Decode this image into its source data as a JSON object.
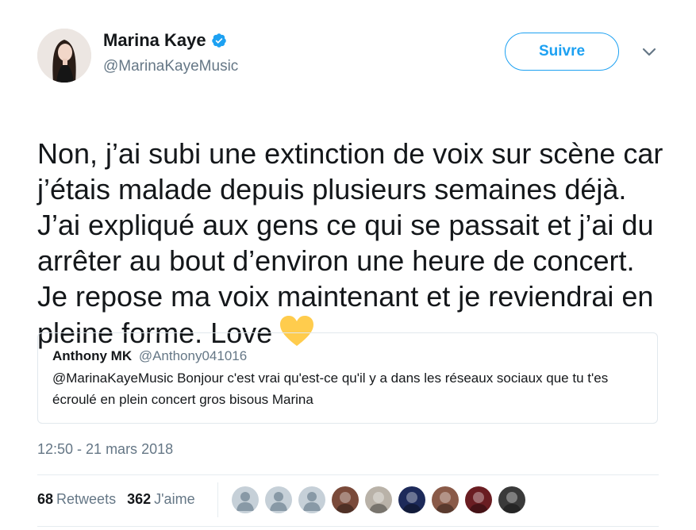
{
  "author": {
    "name": "Marina Kaye",
    "handle": "@MarinaKayeMusic",
    "verified": true
  },
  "header": {
    "follow_label": "Suivre"
  },
  "tweet": {
    "text": "Non, j’ai subi une extinction de voix sur scène car j’étais malade depuis plusieurs semaines déjà. J’ai expliqué aux gens ce qui se passait et j’ai du arrêter au bout d’environ une heure de concert. Je repose ma voix maintenant et je reviendrai en pleine forme. Love",
    "emoji": "yellow-heart-icon"
  },
  "quote": {
    "name": "Anthony MK",
    "handle": "@Anthony041016",
    "text": "@MarinaKayeMusic Bonjour c'est vrai qu'est-ce qu'il y a dans les réseaux sociaux que tu t'es écroulé en plein concert gros bisous Marina"
  },
  "timestamp": "12:50 - 21 mars 2018",
  "stats": {
    "retweets_count": "68",
    "retweets_label": "Retweets",
    "likes_count": "362",
    "likes_label": "J'aime"
  },
  "likers": [
    {
      "type": "default",
      "color": "#c6d0d8"
    },
    {
      "type": "default",
      "color": "#c6d0d8"
    },
    {
      "type": "default",
      "color": "#c6d0d8"
    },
    {
      "type": "photo",
      "color": "#7a4a3a"
    },
    {
      "type": "photo",
      "color": "#b9b2a8"
    },
    {
      "type": "photo",
      "color": "#1d2a5a"
    },
    {
      "type": "photo",
      "color": "#8a5a48"
    },
    {
      "type": "photo",
      "color": "#6a1d22"
    },
    {
      "type": "photo",
      "color": "#3a3a3a"
    }
  ],
  "colors": {
    "accent": "#1da1f2",
    "secondary_text": "#657786",
    "heart": "#ffcc4d"
  }
}
